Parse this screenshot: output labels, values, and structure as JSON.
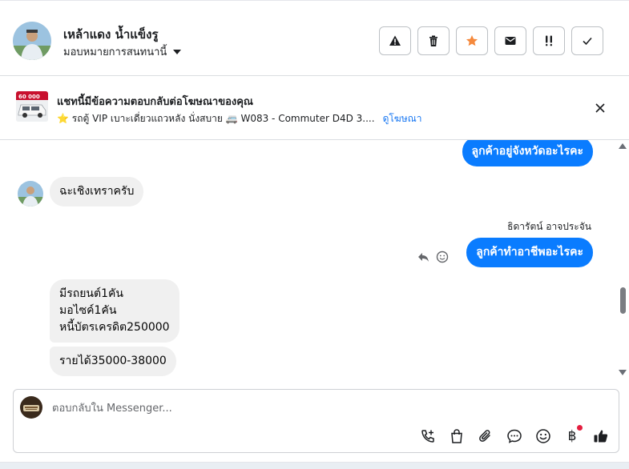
{
  "header": {
    "contact_name": "เหล้าแดง น้ำแข็งรู",
    "assign_label": "มอบหมายการสนทนานี้",
    "actions": [
      {
        "icon": "warning-icon",
        "name": "report-button"
      },
      {
        "icon": "trash-icon",
        "name": "delete-button"
      },
      {
        "icon": "star-icon",
        "name": "star-button"
      },
      {
        "icon": "envelope-icon",
        "name": "mark-unread-button"
      },
      {
        "icon": "follow-up-icon",
        "name": "follow-up-button"
      },
      {
        "icon": "check-icon",
        "name": "mark-done-button"
      }
    ],
    "star_color": "#f5893c"
  },
  "ad": {
    "title": "แชทนี้มีข้อความตอบกลับต่อโฆษณาของคุณ",
    "thumb_price": "60 000",
    "description": "⭐ รถตู้ VIP เบาะเดี่ยวแถวหลัง นั่งสบาย 🚐 W083 - Commuter D4D 3....",
    "link_label": "ดูโฆษณา"
  },
  "messages": {
    "out_1": "ลูกค้าอยู่จังหวัดอะไรคะ",
    "in_1": "ฉะเชิงเทราครับ",
    "sender_2": "ธิดารัตน์ อาจประจัน",
    "out_2": "ลูกค้าทำอาชีพอะไรคะ",
    "in_2_lines": [
      "มีรถยนต์1คัน",
      "มอไซค์1คัน",
      "หนี้บัตรเครดิต250000"
    ],
    "in_3": "รายได้35000-38000"
  },
  "composer": {
    "placeholder": "ตอบกลับใน Messenger...",
    "baht_symbol": "฿",
    "tools": [
      "call-plus-icon",
      "shopping-bag-icon",
      "paperclip-icon",
      "chat-bubble-icon",
      "emoji-icon",
      "baht-icon",
      "thumbs-up-icon"
    ]
  },
  "colors": {
    "outgoing_bubble": "#0a7cff",
    "incoming_bubble": "#f0f0f0",
    "link": "#1877f2",
    "notification_dot": "#e41e3f"
  }
}
